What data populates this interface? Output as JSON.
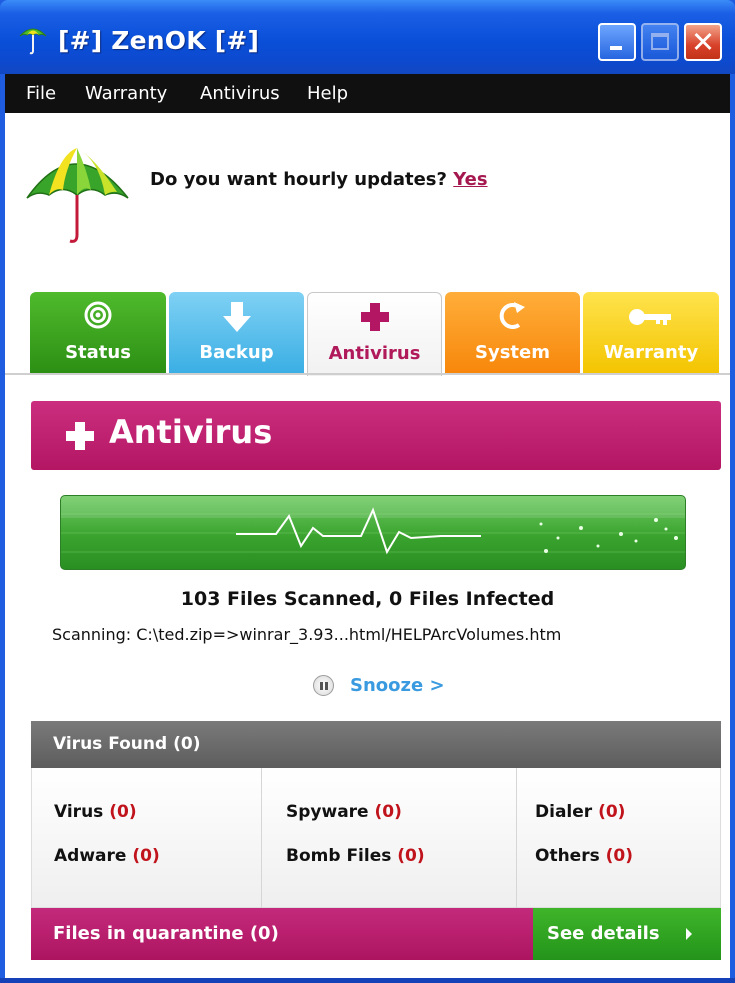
{
  "window": {
    "title": "[#] ZenOK [#]",
    "close_glyph": "✕"
  },
  "menu": {
    "items": [
      "File",
      "Warranty",
      "Antivirus",
      "Help"
    ]
  },
  "update_prompt": {
    "question": "Do you want hourly updates?",
    "link": "Yes"
  },
  "tabs": [
    {
      "label": "Status",
      "icon": "target-icon"
    },
    {
      "label": "Backup",
      "icon": "down-arrow-icon"
    },
    {
      "label": "Antivirus",
      "icon": "plus-icon",
      "active": true
    },
    {
      "label": "System",
      "icon": "refresh-icon"
    },
    {
      "label": "Warranty",
      "icon": "key-icon"
    }
  ],
  "antivirus": {
    "header": "Antivirus",
    "summary": "103 Files Scanned, 0 Files Infected",
    "scanning": "Scanning: C:\\ted.zip=>winrar_3.93...html/HELPArcVolumes.htm",
    "snooze": "Snooze >"
  },
  "virus_found": {
    "title": "Virus Found (0)",
    "items": [
      {
        "label": "Virus",
        "count": "(0)"
      },
      {
        "label": "Adware",
        "count": "(0)"
      },
      {
        "label": "Spyware",
        "count": "(0)"
      },
      {
        "label": "Bomb Files",
        "count": "(0)"
      },
      {
        "label": "Dialer",
        "count": "(0)"
      },
      {
        "label": "Others",
        "count": "(0)"
      }
    ]
  },
  "quarantine": {
    "label": "Files in quarantine (0)",
    "details": "See details"
  },
  "colors": {
    "accent_magenta": "#b31663",
    "status_green": "#2c8f14",
    "backup_blue": "#3aaee4",
    "system_orange": "#f7870b",
    "warranty_yellow": "#f3c400",
    "count_red": "#c0131b"
  }
}
